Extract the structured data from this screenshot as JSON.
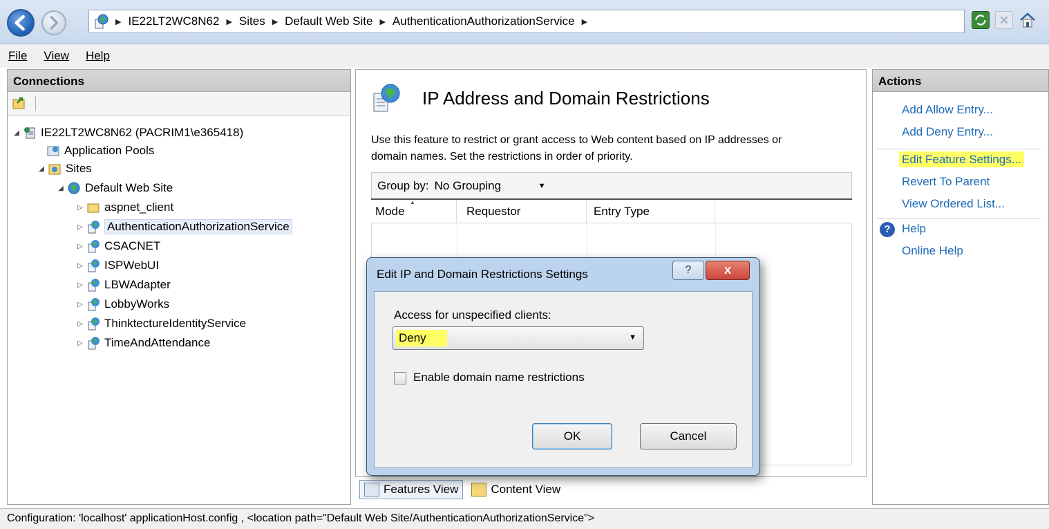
{
  "address_bar": {
    "breadcrumbs": [
      "IE22LT2WC8N62",
      "Sites",
      "Default Web Site",
      "AuthenticationAuthorizationService"
    ]
  },
  "menu": {
    "items": [
      "File",
      "View",
      "Help"
    ]
  },
  "connections": {
    "title": "Connections",
    "server_node": "IE22LT2WC8N62 (PACRIM1\\e365418)",
    "app_pools": "Application Pools",
    "sites": "Sites",
    "default_site": "Default Web Site",
    "apps": [
      "aspnet_client",
      "AuthenticationAuthorizationService",
      "CSACNET",
      "ISPWebUI",
      "LBWAdapter",
      "LobbyWorks",
      "ThinktectureIdentityService",
      "TimeAndAttendance"
    ]
  },
  "feature": {
    "title": "IP Address and Domain Restrictions",
    "description_line1": "Use this feature to restrict or grant access to Web content based on IP addresses or",
    "description_line2": "domain names. Set the restrictions in order of priority.",
    "group_by_label": "Group by:",
    "group_by_value": "No Grouping",
    "columns": [
      "Mode",
      "Requestor",
      "Entry Type"
    ]
  },
  "view_tabs": {
    "features": "Features View",
    "content": "Content View"
  },
  "actions": {
    "title": "Actions",
    "add_allow": "Add Allow Entry...",
    "add_deny": "Add Deny Entry...",
    "edit_settings": "Edit Feature Settings...",
    "revert": "Revert To Parent",
    "view_ordered": "View Ordered List...",
    "help": "Help",
    "online_help": "Online Help"
  },
  "dialog": {
    "title": "Edit IP and Domain Restrictions Settings",
    "access_label": "Access for unspecified clients:",
    "access_value": "Deny",
    "checkbox_label": "Enable domain name restrictions",
    "checkbox_checked": false,
    "ok": "OK",
    "cancel": "Cancel",
    "help_glyph": "?",
    "close_glyph": "X"
  },
  "status_bar": {
    "text": "Configuration: 'localhost' applicationHost.config , <location path=\"Default Web Site/AuthenticationAuthorizationService\">"
  },
  "colors": {
    "highlight": "#ffff66",
    "link": "#1f6ab8",
    "close_button": "#c9463d"
  }
}
